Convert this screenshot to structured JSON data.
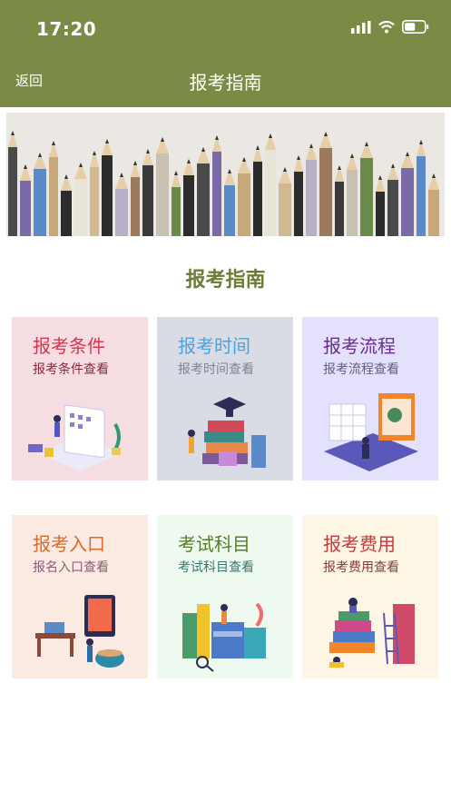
{
  "status_bar": {
    "time": "17:20"
  },
  "nav": {
    "back_label": "返回",
    "title": "报考指南"
  },
  "section": {
    "title": "报考指南"
  },
  "cards": [
    {
      "title": "报考条件",
      "subtitle": "报考条件查看",
      "bg": "#f5dde1",
      "title_color": "#d9344f",
      "sub_color": "#8a2a3a"
    },
    {
      "title": "报考时间",
      "subtitle": "报考时间查看",
      "bg": "#d9dce4",
      "title_color": "#4aa3e0",
      "sub_color": "#7a8594"
    },
    {
      "title": "报考流程",
      "subtitle": "报考流程查看",
      "bg": "#e3e1fb",
      "title_color": "#6a2f8c",
      "sub_color": "#6b5a86"
    },
    {
      "title": "报考入口",
      "subtitle": "报名入口查看",
      "bg": "#fbeae2",
      "title_color": "#d96a28",
      "sub_color": "#8a5a78"
    },
    {
      "title": "考试科目",
      "subtitle": "考试科目查看",
      "bg": "#eefaef",
      "title_color": "#5a7a2a",
      "sub_color": "#2f7a73"
    },
    {
      "title": "报考费用",
      "subtitle": "报考费用查看",
      "bg": "#fdf6e4",
      "title_color": "#c73a3a",
      "sub_color": "#8a3a3a"
    }
  ],
  "colors": {
    "header_bg": "#7b8b46",
    "section_title": "#6b7d38"
  }
}
